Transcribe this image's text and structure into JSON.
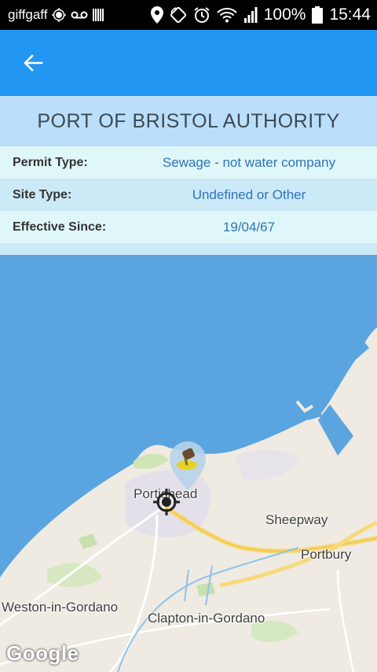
{
  "status_bar": {
    "carrier": "giffgaff",
    "battery": "100%",
    "time": "15:44"
  },
  "app_bar": {
    "back_icon": "arrow-back-icon",
    "color": "#2196f3"
  },
  "title": "PORT OF BRISTOL AUTHORITY",
  "details": [
    {
      "label": "Permit Type:",
      "value": "Sewage - not water company"
    },
    {
      "label": "Site Type:",
      "value": "Undefined or Other"
    },
    {
      "label": "Effective Since:",
      "value": "19/04/67"
    }
  ],
  "map": {
    "places": {
      "portishead": "Portishead",
      "sheepway": "Sheepway",
      "portbury": "Portbury",
      "weston": "Weston-in-Gordano",
      "clapton": "Clapton-in-Gordano"
    },
    "marker_icon": "sewage-discharge-marker-icon",
    "location_icon": "my-location-icon",
    "attribution": "Google",
    "water_color": "#5aa5df",
    "land_color": "#efeae2"
  }
}
